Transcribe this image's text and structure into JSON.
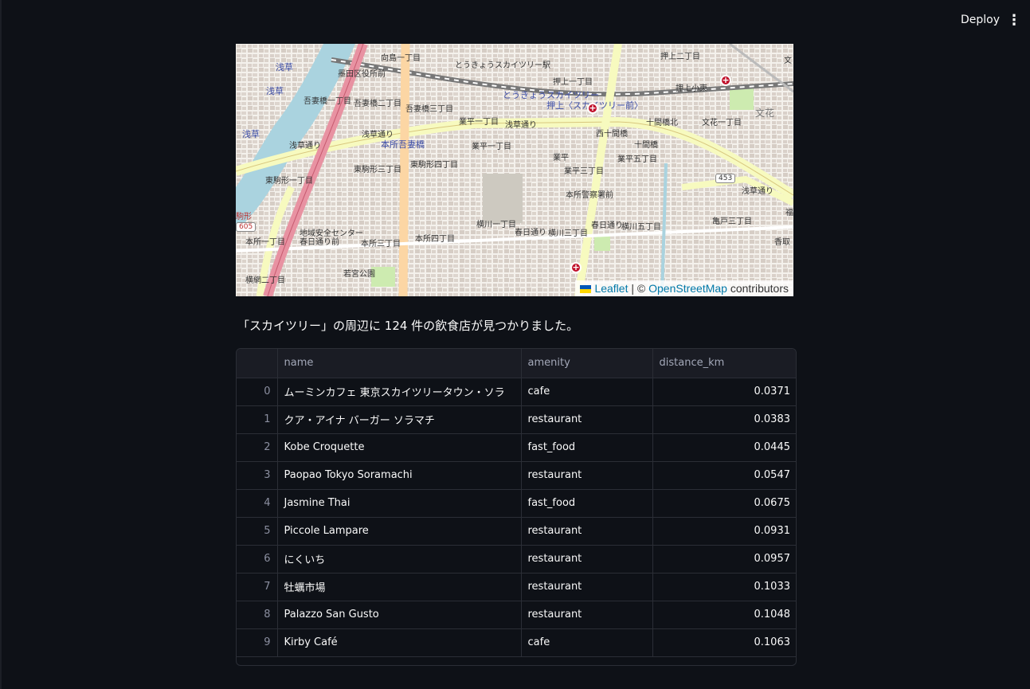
{
  "toolbar": {
    "deploy_label": "Deploy",
    "menu_icon": "vertical-ellipsis-icon",
    "menu_glyph": "⋮"
  },
  "map": {
    "labels": {
      "asakusa1": "浅草",
      "asakusa2": "浅草",
      "asakusa3": "浅草",
      "mukoujima": "向島一丁目",
      "sumida_office": "墨田区役所前",
      "azumabashi1": "吾妻橋一丁目",
      "azumabashi2": "吾妻橋二丁目",
      "azumabashi3": "吾妻橋三丁目",
      "skytree_station": "とうきょうスカイツリー駅",
      "skytree_station_blue": "とうきょうスカイツリー",
      "oshiage_station": "押上〈スカイツリー前〉",
      "oshiage1": "押上一丁目",
      "oshiage2": "押上二丁目",
      "oshiage_elem": "押上小東",
      "narihira1": "業平一丁目",
      "narihira_area": "業平",
      "narihira3": "業平三丁目",
      "narihira5": "業平五丁目",
      "asakusa_dori1": "浅草通り",
      "asakusa_dori2": "浅草通り",
      "asakusa_dori3": "浅草通り",
      "asakusa_dori4": "浅草通り",
      "honjo_azumabashi": "本所吾妻橋",
      "higashikomagata3": "東駒形三丁目",
      "higashikomagata4": "東駒形四丁目",
      "higashikomagata1": "東駒形一丁目",
      "jikkenbashi": "十間橋",
      "jikkenbashi_n": "十間橋北",
      "nishi_jikkenbashi": "西十間橋",
      "bunka1": "文花一丁目",
      "bunka": "文花",
      "honjo_police": "本所警察署前",
      "yokokawa1": "横川一丁目",
      "yokokawa3": "横川三丁目",
      "yokokawa5": "横川五丁目",
      "kasuga1": "春日通り",
      "kasuga2": "春日通り",
      "honjo1": "本所一丁目",
      "honjo3": "本所三丁目",
      "honjo4": "本所四丁目",
      "safety_center": "地域安全センター春日通り前",
      "wakamiya_park": "若宮公園",
      "mitsume": "三ツ目通り",
      "kitajikkengawa": "北十間川",
      "kameido3": "亀戸三丁目",
      "kameido_katori": "香取",
      "yokoami2": "横網二丁目",
      "tower_road": "タワービュー通り",
      "komagata": "駒形",
      "route_605": "605",
      "route_453": "453",
      "sumida": "墨田区",
      "fuku": "福",
      "bun": "文"
    },
    "attribution": {
      "leaflet": "Leaflet",
      "separator": "| ©",
      "osm": "OpenStreetMap",
      "contributors": "contributors"
    }
  },
  "result_text": "「スカイツリー」の周辺に 124 件の飲食店が見つかりました。",
  "table": {
    "columns": [
      "",
      "name",
      "amenity",
      "distance_km"
    ],
    "rows": [
      {
        "idx": "0",
        "name": "ムーミンカフェ 東京スカイツリータウン・ソラ",
        "amenity": "cafe",
        "distance_km": "0.0371"
      },
      {
        "idx": "1",
        "name": "クア・アイナ バーガー ソラマチ",
        "amenity": "restaurant",
        "distance_km": "0.0383"
      },
      {
        "idx": "2",
        "name": "Kobe Croquette",
        "amenity": "fast_food",
        "distance_km": "0.0445"
      },
      {
        "idx": "3",
        "name": "Paopao Tokyo Soramachi",
        "amenity": "restaurant",
        "distance_km": "0.0547"
      },
      {
        "idx": "4",
        "name": "Jasmine Thai",
        "amenity": "fast_food",
        "distance_km": "0.0675"
      },
      {
        "idx": "5",
        "name": "Piccole Lampare",
        "amenity": "restaurant",
        "distance_km": "0.0931"
      },
      {
        "idx": "6",
        "name": "にくいち",
        "amenity": "restaurant",
        "distance_km": "0.0957"
      },
      {
        "idx": "7",
        "name": "牡蠣市場",
        "amenity": "restaurant",
        "distance_km": "0.1033"
      },
      {
        "idx": "8",
        "name": "Palazzo San Gusto",
        "amenity": "restaurant",
        "distance_km": "0.1048"
      },
      {
        "idx": "9",
        "name": "Kirby Café",
        "amenity": "cafe",
        "distance_km": "0.1063"
      }
    ]
  }
}
